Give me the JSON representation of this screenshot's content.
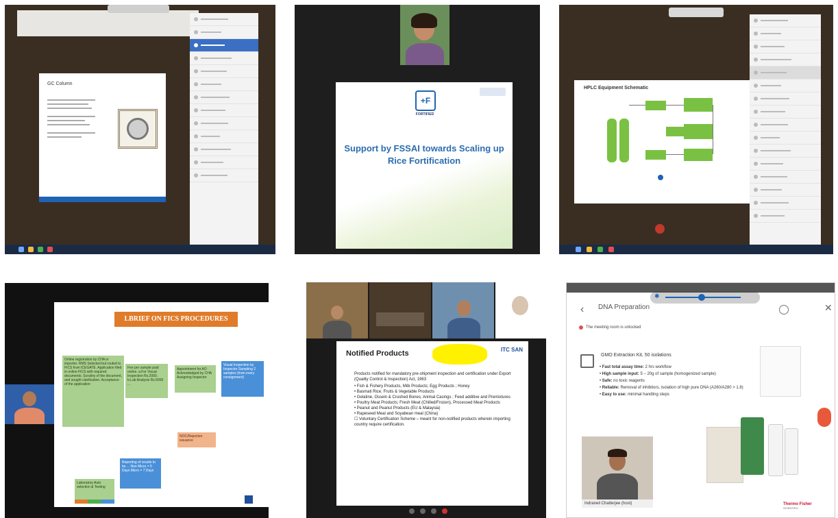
{
  "panel1": {
    "slide_title": "GC Column"
  },
  "panel2": {
    "logo_text": "+F",
    "logo_caption": "FORTIFIED",
    "title_line1": "Support by FSSAI towards Scaling up",
    "title_line2": "Rice Fortification"
  },
  "panel3": {
    "slide_title": "HPLC Equipment Schematic"
  },
  "panel4": {
    "banner": "LBRIEF ON FICS PROCEDURES",
    "boxes": [
      "Online registration by CHA or importer. RMS Selected but routed to FICS from ICEGATE. Application filed in online FICS with required documents. Scrutiny of the document, and sought clarification. Acceptance of the application",
      "Fee per sample paid online. a.For Visual Inspection Rs.2000. b.Lab Analysis Rs.5000 ...",
      "Appointment for AO Acknowledged by CHA Assigning Inspector",
      "Visual Inspection by Inspector Sampling 2 samples (from every consignment)",
      "NOC/Rejection issuance",
      "Reporting of results to be ... Non Micro = 5 Days Micro = 7 Days",
      "Laboratory Auto selection & Testing"
    ]
  },
  "panel5": {
    "slide_title": "Notified Products",
    "badge": "ITC SAN",
    "intro": "Products notified for mandatory pre-shipment inspection and certification under Export (Quality Control & Inspection) Act, 1963",
    "bullets": [
      "Fish & Fishery Products, Milk Products; Egg Products ; Honey",
      "Basmati Rice; Fruits & Vegetable Products",
      "Gelatine, Ossein & Crushed Bones; Animal Casings ; Feed additive and Premixtures",
      "Poultry Meat Products; Fresh Meat (Chilled/Frozen), Processed Meat Products",
      "Peanut and Peanut Products (EU & Malaysia)",
      "Rapeseed Meal and Soyabean meal (China)",
      "Voluntary Certification Scheme – meant for non-notified products wherein importing country require certification."
    ]
  },
  "panel6": {
    "header_title": "DNA Preparation",
    "notice": "The meeting room is unlocked",
    "product_title": "GMO Extraction Kit, 50 isolations",
    "bullets": [
      {
        "label": "Fast total assay time:",
        "text": "2 hrs workflow"
      },
      {
        "label": "High sample input:",
        "text": "5 – 20g of sample (homogenized sample)"
      },
      {
        "label": "Safe:",
        "text": "no toxic reagents"
      },
      {
        "label": "Reliable:",
        "text": "Removal of inhibitors, isolation of high pure DNA (A260/A280 > 1.8)"
      },
      {
        "label": "Easy to use:",
        "text": "minimal handling steps"
      }
    ],
    "presenter": "Indraneil Chatterjee (host)",
    "brand_line1": "Thermo Fisher",
    "brand_line2": "SCIENTIFIC"
  },
  "colors": {
    "fics_green": "#a9d08e",
    "fics_blue": "#4a90d9",
    "fics_orange": "#f2b48a",
    "banner_orange": "#e07b2a",
    "hplc_green": "#7ac143",
    "itc_blue": "#1f4e9b"
  }
}
